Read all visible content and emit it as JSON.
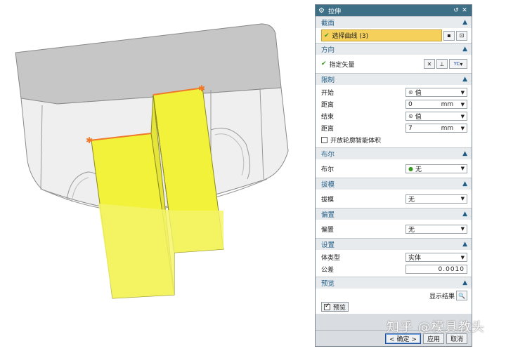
{
  "dialog": {
    "title": "拉伸",
    "title_icon": "gear-icon",
    "reset_icon": "reset-icon",
    "close_icon": "close-icon"
  },
  "sections": {
    "section": {
      "title": "截面",
      "select_curve_label": "选择曲线 (3)"
    },
    "direction": {
      "title": "方向",
      "vector_label": "指定矢量",
      "vector_option": "YC"
    },
    "limits": {
      "title": "限制",
      "start_label": "开始",
      "start_value": "值",
      "start_dist_label": "距离",
      "start_dist_value": "0",
      "start_dist_unit": "mm",
      "end_label": "结束",
      "end_value": "值",
      "end_dist_label": "距离",
      "end_dist_value": "7",
      "end_dist_unit": "mm",
      "open_profile_label": "开放轮廓智能体积"
    },
    "boolean": {
      "title": "布尔",
      "label": "布尔",
      "value": "无"
    },
    "draft": {
      "title": "拔模",
      "label": "拔模",
      "value": "无"
    },
    "offset": {
      "title": "偏置",
      "label": "偏置",
      "value": "无"
    },
    "settings": {
      "title": "设置",
      "body_type_label": "体类型",
      "body_type_value": "实体",
      "tolerance_label": "公差",
      "tolerance_value": "0.0010"
    },
    "preview": {
      "title": "预览",
      "show_result_label": "显示结果",
      "preview_label": "预览"
    }
  },
  "footer": {
    "ok_label": "< 确定 >",
    "apply_label": "应用",
    "cancel_label": "取消"
  },
  "watermark": "知乎 @模具教头",
  "colors": {
    "title_bar": "#3d6f86",
    "section_title": "#1f5d87",
    "highlight": "#f5d15c",
    "extrude_yellow": "#f2f23a",
    "model_gray": "#c8c8c8"
  }
}
